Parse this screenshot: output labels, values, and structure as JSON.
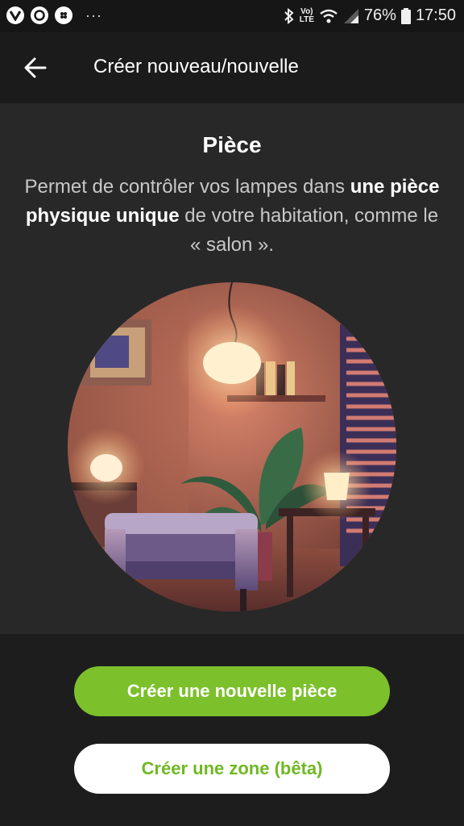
{
  "status_bar": {
    "overflow_dots": "···",
    "network": "LTE",
    "network_top": "Vo)",
    "battery": "76%",
    "time": "17:50"
  },
  "app_bar": {
    "title": "Créer nouveau/nouvelle",
    "back_icon": "arrow-left-icon"
  },
  "content": {
    "title": "Pièce",
    "description": {
      "part1": "Permet de contrôler vos lampes dans ",
      "bold": "une pièce physique unique",
      "part2": " de votre habitation, comme le « salon »."
    }
  },
  "buttons": {
    "primary": "Créer une nouvelle pièce",
    "secondary": "Créer une zone (bêta)"
  },
  "colors": {
    "accent_green": "#7cc02c",
    "background": "#282828"
  }
}
